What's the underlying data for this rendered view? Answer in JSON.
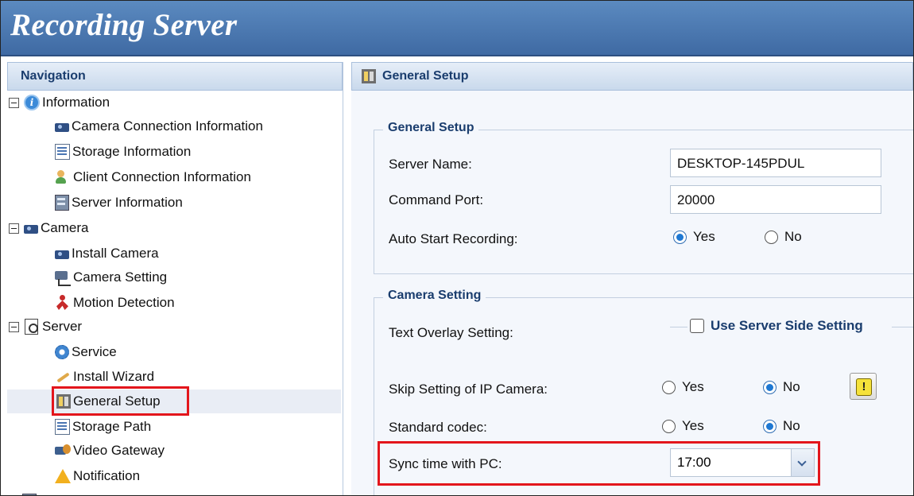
{
  "app": {
    "title": "Recording Server"
  },
  "nav": {
    "header": "Navigation",
    "items": [
      {
        "label": "Information",
        "icon": "info-icon",
        "level": 0
      },
      {
        "label": "Camera Connection Information",
        "icon": "camera-connection-icon",
        "level": 1
      },
      {
        "label": "Storage Information",
        "icon": "storage-icon",
        "level": 1
      },
      {
        "label": "Client Connection Information",
        "icon": "client-icon",
        "level": 1
      },
      {
        "label": "Server Information",
        "icon": "server-info-icon",
        "level": 1
      },
      {
        "label": "Camera",
        "icon": "camera-icon",
        "level": 0
      },
      {
        "label": "Install Camera",
        "icon": "camera-icon",
        "level": 1
      },
      {
        "label": "Camera Setting",
        "icon": "camera-setting-icon",
        "level": 1
      },
      {
        "label": "Motion Detection",
        "icon": "motion-icon",
        "level": 1
      },
      {
        "label": "Server",
        "icon": "server-icon",
        "level": 0
      },
      {
        "label": "Service",
        "icon": "gear-icon",
        "level": 1
      },
      {
        "label": "Install Wizard",
        "icon": "wizard-icon",
        "level": 1
      },
      {
        "label": "General Setup",
        "icon": "general-setup-icon",
        "level": 1,
        "selected": true
      },
      {
        "label": "Storage Path",
        "icon": "storage-icon",
        "level": 1
      },
      {
        "label": "Video Gateway",
        "icon": "video-gateway-icon",
        "level": 1
      },
      {
        "label": "Notification",
        "icon": "warning-icon",
        "level": 1
      }
    ]
  },
  "main": {
    "header": "General Setup",
    "general": {
      "legend": "General Setup",
      "server_name_label": "Server Name:",
      "server_name_value": "DESKTOP-145PDUL",
      "command_port_label": "Command Port:",
      "command_port_value": "20000",
      "auto_start_label": "Auto Start Recording:",
      "auto_start_yes": "Yes",
      "auto_start_no": "No",
      "auto_start_selected": "Yes"
    },
    "camera": {
      "legend": "Camera Setting",
      "text_overlay_label": "Text Overlay Setting:",
      "use_server_side": "Use Server Side Setting",
      "skip_label": "Skip Setting of IP Camera:",
      "skip_yes": "Yes",
      "skip_no": "No",
      "skip_selected": "No",
      "warn_glyph": "!",
      "codec_label": "Standard codec:",
      "codec_yes": "Yes",
      "codec_no": "No",
      "codec_selected": "No",
      "sync_label": "Sync time with PC:",
      "sync_value": "17:00"
    }
  },
  "colors": {
    "title_bar": "#4a76ad",
    "highlight": "#e3161c",
    "accent": "#1a3d6e"
  }
}
